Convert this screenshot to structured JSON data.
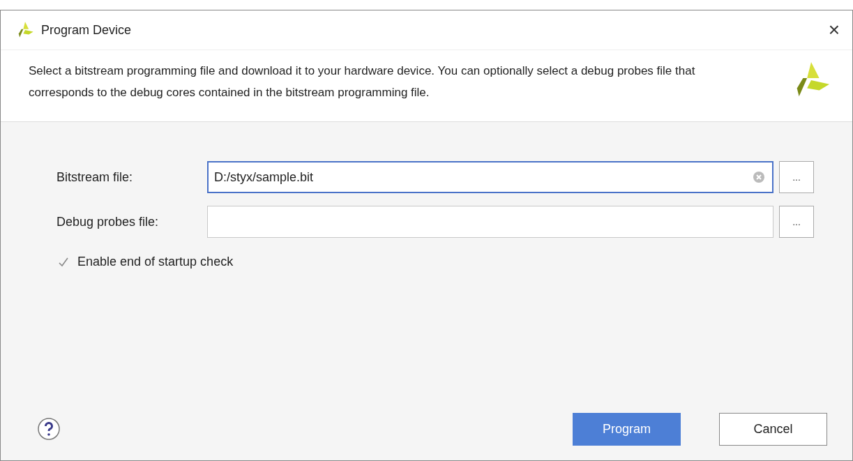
{
  "window": {
    "title": "Program Device",
    "close": "×"
  },
  "description": "Select a bitstream programming file and download it to your hardware device. You can optionally select a debug probes file that corresponds to the debug cores contained in the bitstream programming file.",
  "fields": [
    {
      "label": "Bitstream file:",
      "value": "D:/styx/sample.bit",
      "focused": true
    },
    {
      "label": "Debug probes file:",
      "focused": false
    }
  ],
  "browse_buttons": [
    "...",
    "..."
  ],
  "checkbox": {
    "label": "Enable end of startup check",
    "checked": true
  },
  "buttons": [
    {
      "label": "Program",
      "kind": "primary"
    },
    {
      "label": "Cancel",
      "kind": "secondary"
    }
  ]
}
